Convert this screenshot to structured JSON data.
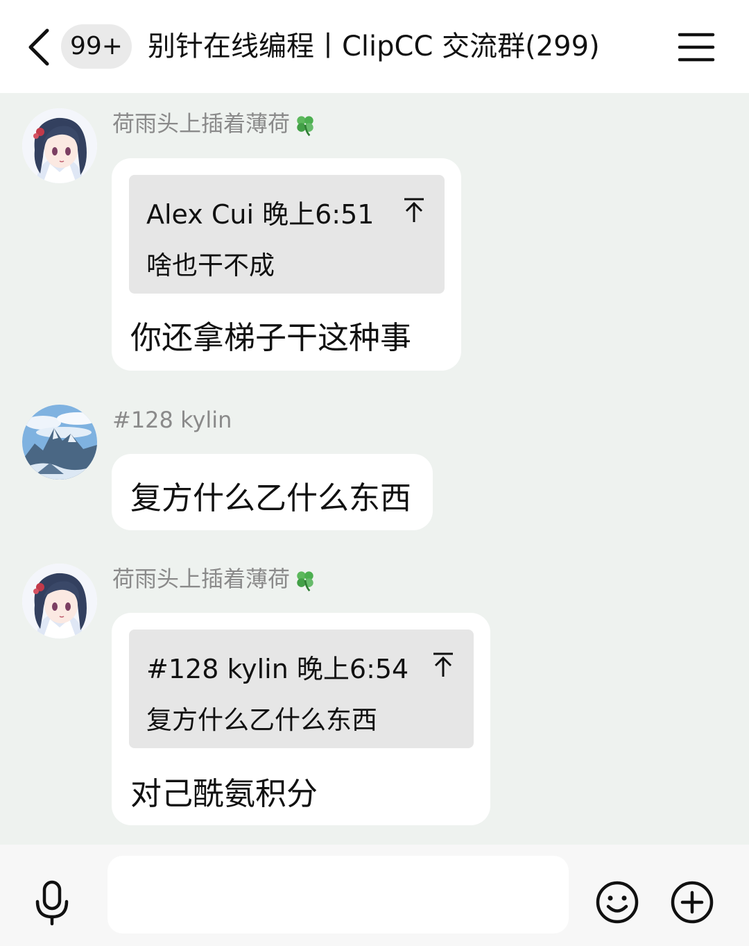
{
  "header": {
    "back_icon": "chevron-left-icon",
    "unread_count": "99+",
    "title": "别针在线编程丨ClipCC 交流群(299)",
    "menu_icon": "hamburger-menu-icon"
  },
  "messages": [
    {
      "sender": "荷雨头上插着薄荷",
      "sender_emoji": "four-leaf-clover-icon",
      "avatar": "anime-girl-avatar",
      "quote": {
        "author": "Alex Cui",
        "time": "晚上6:51",
        "text": "啥也干不成"
      },
      "text": "你还拿梯子干这种事"
    },
    {
      "sender": "#128 kylin",
      "avatar": "mountain-landscape-avatar",
      "text": "复方什么乙什么东西"
    },
    {
      "sender": "荷雨头上插着薄荷",
      "sender_emoji": "four-leaf-clover-icon",
      "avatar": "anime-girl-avatar",
      "quote": {
        "author": "#128 kylin",
        "time": "晚上6:54",
        "text": "复方什么乙什么东西"
      },
      "text": "对己酰氨积分"
    }
  ],
  "input_bar": {
    "voice_icon": "microphone-icon",
    "message_value": "",
    "emoji_icon": "smiley-face-icon",
    "more_icon": "plus-circle-icon"
  },
  "colors": {
    "chat_background": "#eef2ef",
    "bubble": "#ffffff",
    "quote_background": "#e6e6e6",
    "sender_text": "#8a8a8a",
    "clover_green": "#4caf50"
  }
}
